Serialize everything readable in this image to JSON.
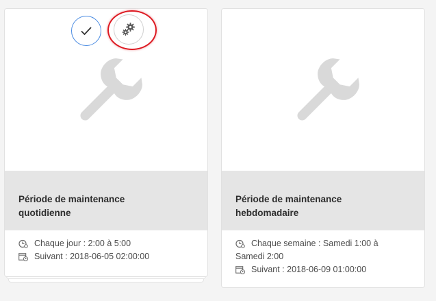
{
  "cards": [
    {
      "title_line1": "Période de maintenance",
      "title_line2": "quotidienne",
      "schedule": "Chaque jour : 2:00 à 5:00",
      "next": "Suivant : 2018-06-05 02:00:00",
      "thumbnail_icon": "wrench-icon",
      "schedule_icon": "clock-icon",
      "next_icon": "calendar-clock-icon",
      "selected": true
    },
    {
      "title_line1": "Période de maintenance",
      "title_line2": "hebdomadaire",
      "schedule_line1": "Chaque semaine : Samedi 1:00 à",
      "schedule_line2": "Samedi 2:00",
      "next": "Suivant : 2018-06-09 01:00:00",
      "thumbnail_icon": "wrench-icon",
      "schedule_icon": "clock-icon",
      "next_icon": "calendar-clock-icon",
      "selected": false
    }
  ],
  "quick_actions": [
    {
      "name": "select",
      "icon": "checkmark-icon"
    },
    {
      "name": "properties",
      "icon": "gear-icon",
      "highlighted": true
    }
  ],
  "colors": {
    "page_background": "#f4f4f4",
    "card_background": "#ffffff",
    "title_band": "#e5e5e5",
    "wrench": "#d9d9d9",
    "select_ring": "#4a8be2",
    "highlight_ring": "#dd1a22",
    "text": "#2c2c2c",
    "meta_text": "#4b4b4b"
  }
}
